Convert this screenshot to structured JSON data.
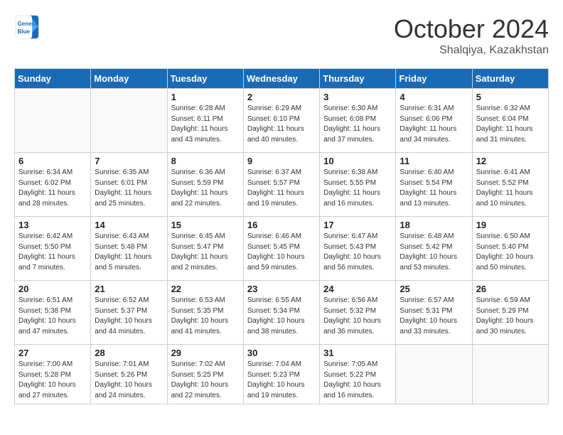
{
  "logo": {
    "line1": "General",
    "line2": "Blue"
  },
  "title": "October 2024",
  "subtitle": "Shalqiya, Kazakhstan",
  "days_header": [
    "Sunday",
    "Monday",
    "Tuesday",
    "Wednesday",
    "Thursday",
    "Friday",
    "Saturday"
  ],
  "weeks": [
    [
      {
        "num": "",
        "sunrise": "",
        "sunset": "",
        "daylight": ""
      },
      {
        "num": "",
        "sunrise": "",
        "sunset": "",
        "daylight": ""
      },
      {
        "num": "1",
        "sunrise": "Sunrise: 6:28 AM",
        "sunset": "Sunset: 6:11 PM",
        "daylight": "Daylight: 11 hours and 43 minutes."
      },
      {
        "num": "2",
        "sunrise": "Sunrise: 6:29 AM",
        "sunset": "Sunset: 6:10 PM",
        "daylight": "Daylight: 11 hours and 40 minutes."
      },
      {
        "num": "3",
        "sunrise": "Sunrise: 6:30 AM",
        "sunset": "Sunset: 6:08 PM",
        "daylight": "Daylight: 11 hours and 37 minutes."
      },
      {
        "num": "4",
        "sunrise": "Sunrise: 6:31 AM",
        "sunset": "Sunset: 6:06 PM",
        "daylight": "Daylight: 11 hours and 34 minutes."
      },
      {
        "num": "5",
        "sunrise": "Sunrise: 6:32 AM",
        "sunset": "Sunset: 6:04 PM",
        "daylight": "Daylight: 11 hours and 31 minutes."
      }
    ],
    [
      {
        "num": "6",
        "sunrise": "Sunrise: 6:34 AM",
        "sunset": "Sunset: 6:02 PM",
        "daylight": "Daylight: 11 hours and 28 minutes."
      },
      {
        "num": "7",
        "sunrise": "Sunrise: 6:35 AM",
        "sunset": "Sunset: 6:01 PM",
        "daylight": "Daylight: 11 hours and 25 minutes."
      },
      {
        "num": "8",
        "sunrise": "Sunrise: 6:36 AM",
        "sunset": "Sunset: 5:59 PM",
        "daylight": "Daylight: 11 hours and 22 minutes."
      },
      {
        "num": "9",
        "sunrise": "Sunrise: 6:37 AM",
        "sunset": "Sunset: 5:57 PM",
        "daylight": "Daylight: 11 hours and 19 minutes."
      },
      {
        "num": "10",
        "sunrise": "Sunrise: 6:38 AM",
        "sunset": "Sunset: 5:55 PM",
        "daylight": "Daylight: 11 hours and 16 minutes."
      },
      {
        "num": "11",
        "sunrise": "Sunrise: 6:40 AM",
        "sunset": "Sunset: 5:54 PM",
        "daylight": "Daylight: 11 hours and 13 minutes."
      },
      {
        "num": "12",
        "sunrise": "Sunrise: 6:41 AM",
        "sunset": "Sunset: 5:52 PM",
        "daylight": "Daylight: 11 hours and 10 minutes."
      }
    ],
    [
      {
        "num": "13",
        "sunrise": "Sunrise: 6:42 AM",
        "sunset": "Sunset: 5:50 PM",
        "daylight": "Daylight: 11 hours and 7 minutes."
      },
      {
        "num": "14",
        "sunrise": "Sunrise: 6:43 AM",
        "sunset": "Sunset: 5:48 PM",
        "daylight": "Daylight: 11 hours and 5 minutes."
      },
      {
        "num": "15",
        "sunrise": "Sunrise: 6:45 AM",
        "sunset": "Sunset: 5:47 PM",
        "daylight": "Daylight: 11 hours and 2 minutes."
      },
      {
        "num": "16",
        "sunrise": "Sunrise: 6:46 AM",
        "sunset": "Sunset: 5:45 PM",
        "daylight": "Daylight: 10 hours and 59 minutes."
      },
      {
        "num": "17",
        "sunrise": "Sunrise: 6:47 AM",
        "sunset": "Sunset: 5:43 PM",
        "daylight": "Daylight: 10 hours and 56 minutes."
      },
      {
        "num": "18",
        "sunrise": "Sunrise: 6:48 AM",
        "sunset": "Sunset: 5:42 PM",
        "daylight": "Daylight: 10 hours and 53 minutes."
      },
      {
        "num": "19",
        "sunrise": "Sunrise: 6:50 AM",
        "sunset": "Sunset: 5:40 PM",
        "daylight": "Daylight: 10 hours and 50 minutes."
      }
    ],
    [
      {
        "num": "20",
        "sunrise": "Sunrise: 6:51 AM",
        "sunset": "Sunset: 5:38 PM",
        "daylight": "Daylight: 10 hours and 47 minutes."
      },
      {
        "num": "21",
        "sunrise": "Sunrise: 6:52 AM",
        "sunset": "Sunset: 5:37 PM",
        "daylight": "Daylight: 10 hours and 44 minutes."
      },
      {
        "num": "22",
        "sunrise": "Sunrise: 6:53 AM",
        "sunset": "Sunset: 5:35 PM",
        "daylight": "Daylight: 10 hours and 41 minutes."
      },
      {
        "num": "23",
        "sunrise": "Sunrise: 6:55 AM",
        "sunset": "Sunset: 5:34 PM",
        "daylight": "Daylight: 10 hours and 38 minutes."
      },
      {
        "num": "24",
        "sunrise": "Sunrise: 6:56 AM",
        "sunset": "Sunset: 5:32 PM",
        "daylight": "Daylight: 10 hours and 36 minutes."
      },
      {
        "num": "25",
        "sunrise": "Sunrise: 6:57 AM",
        "sunset": "Sunset: 5:31 PM",
        "daylight": "Daylight: 10 hours and 33 minutes."
      },
      {
        "num": "26",
        "sunrise": "Sunrise: 6:59 AM",
        "sunset": "Sunset: 5:29 PM",
        "daylight": "Daylight: 10 hours and 30 minutes."
      }
    ],
    [
      {
        "num": "27",
        "sunrise": "Sunrise: 7:00 AM",
        "sunset": "Sunset: 5:28 PM",
        "daylight": "Daylight: 10 hours and 27 minutes."
      },
      {
        "num": "28",
        "sunrise": "Sunrise: 7:01 AM",
        "sunset": "Sunset: 5:26 PM",
        "daylight": "Daylight: 10 hours and 24 minutes."
      },
      {
        "num": "29",
        "sunrise": "Sunrise: 7:02 AM",
        "sunset": "Sunset: 5:25 PM",
        "daylight": "Daylight: 10 hours and 22 minutes."
      },
      {
        "num": "30",
        "sunrise": "Sunrise: 7:04 AM",
        "sunset": "Sunset: 5:23 PM",
        "daylight": "Daylight: 10 hours and 19 minutes."
      },
      {
        "num": "31",
        "sunrise": "Sunrise: 7:05 AM",
        "sunset": "Sunset: 5:22 PM",
        "daylight": "Daylight: 10 hours and 16 minutes."
      },
      {
        "num": "",
        "sunrise": "",
        "sunset": "",
        "daylight": ""
      },
      {
        "num": "",
        "sunrise": "",
        "sunset": "",
        "daylight": ""
      }
    ]
  ]
}
